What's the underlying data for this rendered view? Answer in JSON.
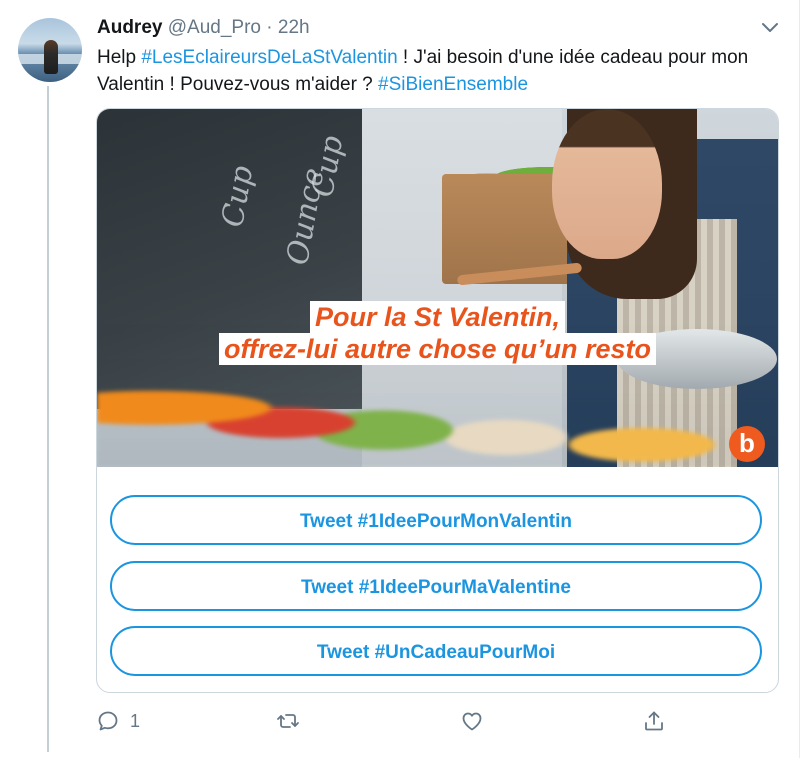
{
  "tweet": {
    "author_name": "Audrey",
    "author_handle": "@Aud_Pro",
    "separator": "·",
    "timestamp": "22h",
    "text_parts": {
      "p1": "Help ",
      "hashtag1": "#LesEclaireursDeLaStValentin",
      "p2": " ! J'ai besoin d'une idée cadeau pour mon Valentin ! Pouvez-vous m'aider ? ",
      "hashtag2": "#SiBienEnsemble"
    }
  },
  "card": {
    "banner_line1": "Pour la St Valentin,",
    "banner_line2": "offrez-lui autre chose qu’un resto",
    "brand_logo": "b",
    "buttons": [
      {
        "label": "Tweet #1IdeePourMonValentin"
      },
      {
        "label": "Tweet #1IdeePourMaValentine"
      },
      {
        "label": "Tweet #UnCadeauPourMoi"
      }
    ]
  },
  "actions": {
    "reply_count": "1",
    "icons": [
      "reply-icon",
      "retweet-icon",
      "like-icon",
      "share-icon"
    ]
  },
  "colors": {
    "accent": "#1b95e0",
    "banner_text": "#e8541c",
    "muted": "#657786",
    "logo": "#ef5a1e"
  }
}
